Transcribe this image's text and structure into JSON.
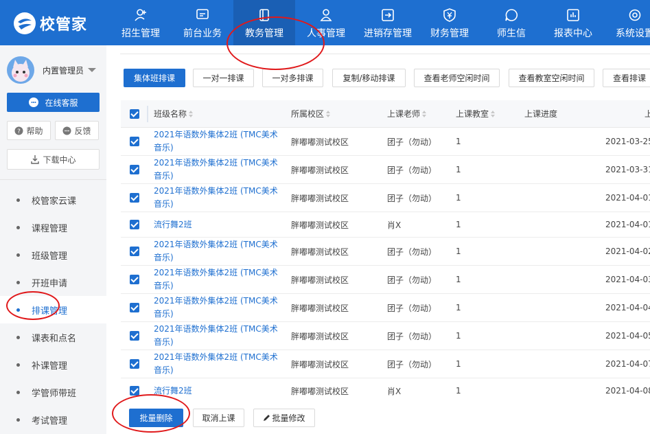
{
  "app": {
    "logo_text": "校管家"
  },
  "nav": [
    {
      "label": "招生管理",
      "icon": "user-plus-icon"
    },
    {
      "label": "前台业务",
      "icon": "monitor-icon"
    },
    {
      "label": "教务管理",
      "icon": "book-icon",
      "active": true
    },
    {
      "label": "人事管理",
      "icon": "person-icon"
    },
    {
      "label": "进销存管理",
      "icon": "box-arrow-icon"
    },
    {
      "label": "财务管理",
      "icon": "yen-shield-icon"
    },
    {
      "label": "师生信",
      "icon": "chat-icon"
    },
    {
      "label": "报表中心",
      "icon": "chart-icon"
    },
    {
      "label": "系统设置",
      "icon": "gear-icon"
    }
  ],
  "sidebar": {
    "user_name": "内置管理员",
    "service_label": "在线客服",
    "help_label": "帮助",
    "feedback_label": "反馈",
    "download_label": "下载中心",
    "items": [
      {
        "label": "校管家云课"
      },
      {
        "label": "课程管理"
      },
      {
        "label": "班级管理"
      },
      {
        "label": "开班申请"
      },
      {
        "label": "排课管理",
        "active": true
      },
      {
        "label": "课表和点名"
      },
      {
        "label": "补课管理"
      },
      {
        "label": "学管师带班"
      },
      {
        "label": "考试管理"
      }
    ]
  },
  "toolbar": {
    "buttons": [
      "集体班排课",
      "一对一排课",
      "一对多排课",
      "复制/移动排课",
      "查看老师空闲时间",
      "查看教室空闲时间",
      "查看排课"
    ]
  },
  "table": {
    "headers": [
      "班级名称",
      "所属校区",
      "上课老师",
      "上课教室",
      "上课进度",
      "上"
    ],
    "rows": [
      {
        "name": "2021年语数外集体2班 (TMC美术音乐)",
        "campus": "胖嘟嘟测试校区",
        "teacher": "团子（勿动）",
        "room": "1",
        "progress": "",
        "date": "2021-03-25"
      },
      {
        "name": "2021年语数外集体2班 (TMC美术音乐)",
        "campus": "胖嘟嘟测试校区",
        "teacher": "团子（勿动）",
        "room": "1",
        "progress": "",
        "date": "2021-03-31"
      },
      {
        "name": "2021年语数外集体2班 (TMC美术音乐)",
        "campus": "胖嘟嘟测试校区",
        "teacher": "团子（勿动）",
        "room": "1",
        "progress": "",
        "date": "2021-04-01"
      },
      {
        "name": "流行舞2班",
        "campus": "胖嘟嘟测试校区",
        "teacher": "肖X",
        "room": "1",
        "progress": "",
        "date": "2021-04-01"
      },
      {
        "name": "2021年语数外集体2班 (TMC美术音乐)",
        "campus": "胖嘟嘟测试校区",
        "teacher": "团子（勿动）",
        "room": "1",
        "progress": "",
        "date": "2021-04-02"
      },
      {
        "name": "2021年语数外集体2班 (TMC美术音乐)",
        "campus": "胖嘟嘟测试校区",
        "teacher": "团子（勿动）",
        "room": "1",
        "progress": "",
        "date": "2021-04-03"
      },
      {
        "name": "2021年语数外集体2班 (TMC美术音乐)",
        "campus": "胖嘟嘟测试校区",
        "teacher": "团子（勿动）",
        "room": "1",
        "progress": "",
        "date": "2021-04-04"
      },
      {
        "name": "2021年语数外集体2班 (TMC美术音乐)",
        "campus": "胖嘟嘟测试校区",
        "teacher": "团子（勿动）",
        "room": "1",
        "progress": "",
        "date": "2021-04-05"
      },
      {
        "name": "2021年语数外集体2班 (TMC美术音乐)",
        "campus": "胖嘟嘟测试校区",
        "teacher": "团子（勿动）",
        "room": "1",
        "progress": "",
        "date": "2021-04-07"
      },
      {
        "name": "流行舞2班",
        "campus": "胖嘟嘟测试校区",
        "teacher": "肖X",
        "room": "1",
        "progress": "",
        "date": "2021-04-08"
      }
    ]
  },
  "footer": {
    "batch_delete": "批量删除",
    "cancel_class": "取消上课",
    "batch_edit": "批量修改"
  },
  "colors": {
    "primary": "#1e6fd0",
    "annotation": "#e0191b"
  }
}
